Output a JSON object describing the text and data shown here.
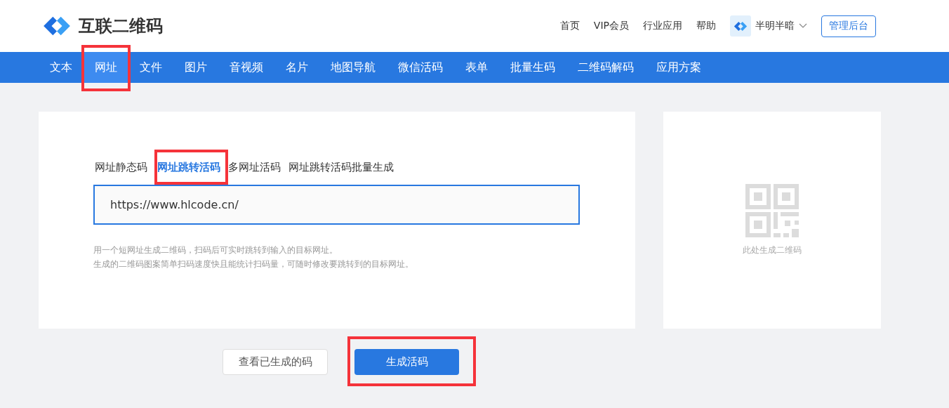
{
  "logo": {
    "text": "互联二维码"
  },
  "top_links": [
    {
      "label": "首页"
    },
    {
      "label": "VIP会员"
    },
    {
      "label": "行业应用"
    },
    {
      "label": "帮助"
    }
  ],
  "user": {
    "name": "半明半暗"
  },
  "admin_button": "管理后台",
  "nav": [
    {
      "label": "文本",
      "selected": false,
      "marked": false
    },
    {
      "label": "网址",
      "selected": true,
      "marked": true
    },
    {
      "label": "文件",
      "selected": false,
      "marked": false
    },
    {
      "label": "图片",
      "selected": false,
      "marked": false
    },
    {
      "label": "音视频",
      "selected": false,
      "marked": false
    },
    {
      "label": "名片",
      "selected": false,
      "marked": false
    },
    {
      "label": "地图导航",
      "selected": false,
      "marked": false
    },
    {
      "label": "微信活码",
      "selected": false,
      "marked": false
    },
    {
      "label": "表单",
      "selected": false,
      "marked": false
    },
    {
      "label": "批量生码",
      "selected": false,
      "marked": false
    },
    {
      "label": "二维码解码",
      "selected": false,
      "marked": false
    },
    {
      "label": "应用方案",
      "selected": false,
      "marked": false
    }
  ],
  "sub_tabs": [
    {
      "label": "网址静态码",
      "selected": false,
      "marked": false
    },
    {
      "label": "网址跳转活码",
      "selected": true,
      "marked": true
    },
    {
      "label": "多网址活码",
      "selected": false,
      "marked": false
    },
    {
      "label": "网址跳转活码批量生成",
      "selected": false,
      "marked": false
    }
  ],
  "url_field": {
    "value": "https://www.hlcode.cn/"
  },
  "hints": [
    "用一个短网址生成二维码，扫码后可实时跳转到输入的目标网址。",
    "生成的二维码图案简单扫码速度快且能统计扫码量，可随时修改要跳转到的目标网址。"
  ],
  "preview": {
    "caption": "此处生成二维码"
  },
  "buttons": [
    {
      "label": "查看已生成的码",
      "kind": "secondary",
      "marked": false
    },
    {
      "label": "生成活码",
      "kind": "primary",
      "marked": true
    }
  ]
}
